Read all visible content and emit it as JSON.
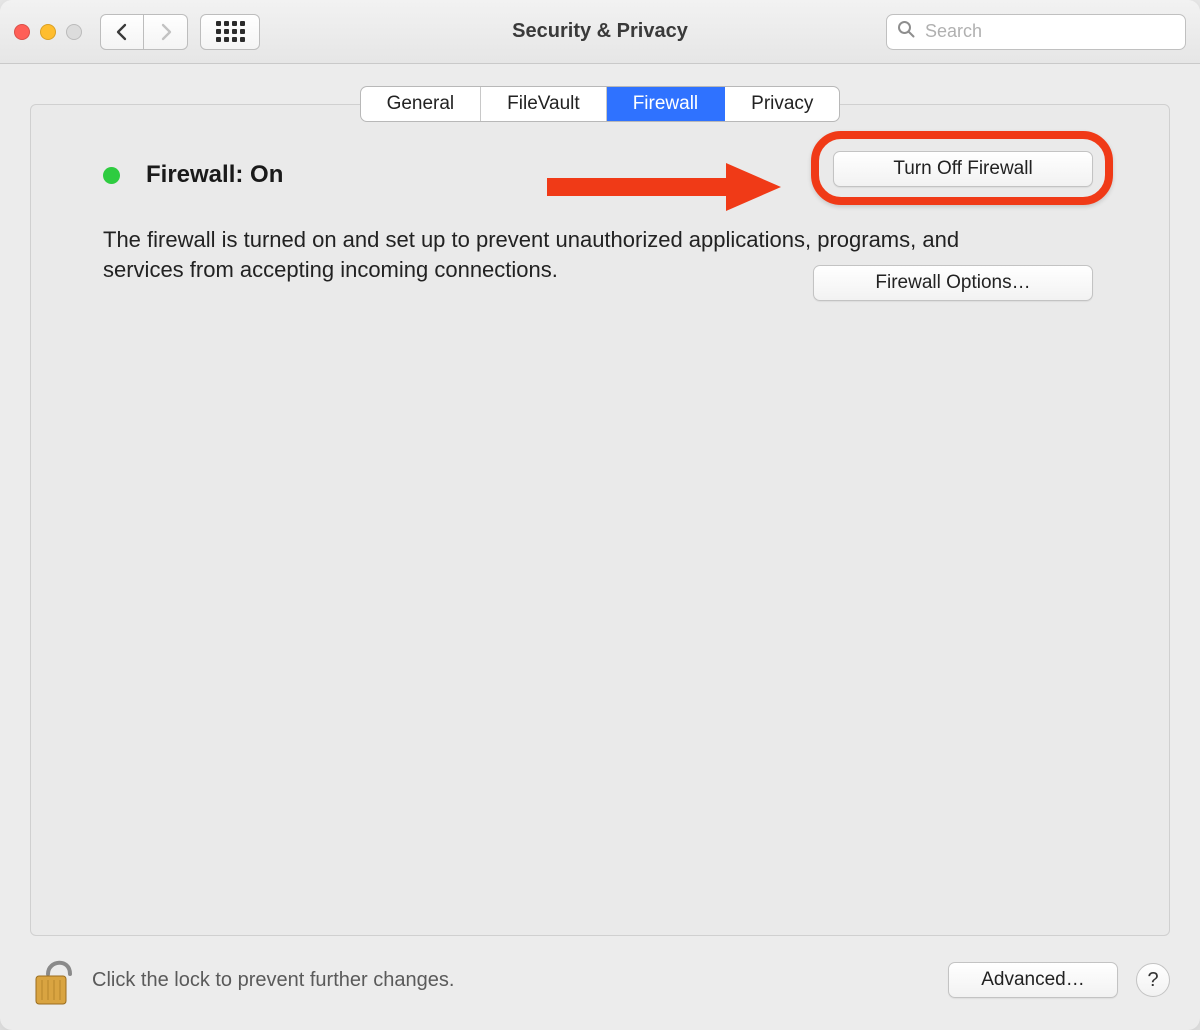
{
  "window": {
    "title": "Security & Privacy"
  },
  "search": {
    "placeholder": "Search",
    "value": ""
  },
  "tabs": {
    "general": "General",
    "filevault": "FileVault",
    "firewall": "Firewall",
    "privacy": "Privacy",
    "active": "firewall"
  },
  "firewall": {
    "status_label": "Firewall: On",
    "status_color": "#2ecc40",
    "description": "The firewall is turned on and set up to prevent unauthorized applications, programs, and services from accepting incoming connections.",
    "toggle_button": "Turn Off Firewall",
    "options_button": "Firewall Options…"
  },
  "footer": {
    "lock_text": "Click the lock to prevent further changes.",
    "advanced_button": "Advanced…",
    "help_label": "?"
  },
  "annotation": {
    "highlight_color": "#f03a17"
  }
}
